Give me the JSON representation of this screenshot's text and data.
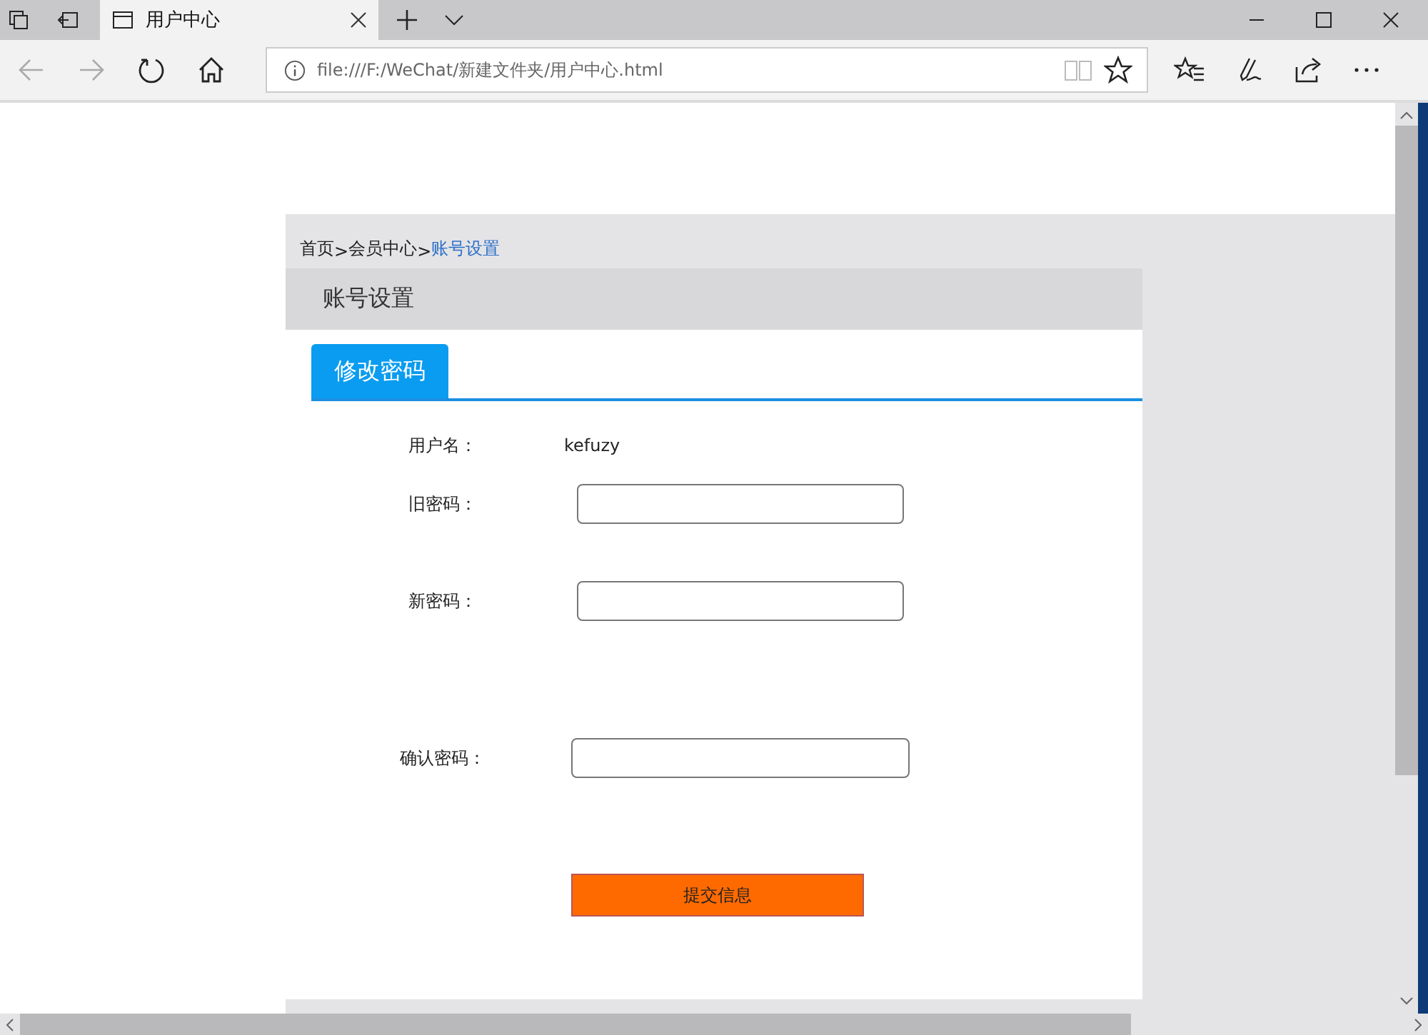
{
  "browser": {
    "tabs": [
      {
        "title": "用户中心",
        "selected": true
      }
    ],
    "address": "file:///F:/WeChat/新建文件夹/用户中心.html"
  },
  "page": {
    "breadcrumb": {
      "separator": ">",
      "items": [
        {
          "label": "首页",
          "selected": false
        },
        {
          "label": "会员中心",
          "selected": false
        },
        {
          "label": "账号设置",
          "selected": true
        }
      ]
    },
    "panel_title": "账号设置",
    "tabs": [
      {
        "label": "修改密码",
        "selected": true
      }
    ],
    "fields": [
      {
        "kind": "text",
        "label": "用户名：",
        "value": "kefuzy"
      },
      {
        "kind": "password",
        "label": "旧密码："
      },
      {
        "kind": "password",
        "label": "新密码："
      },
      {
        "kind": "password",
        "label": "确认密码："
      }
    ],
    "submit": "提交信息"
  }
}
